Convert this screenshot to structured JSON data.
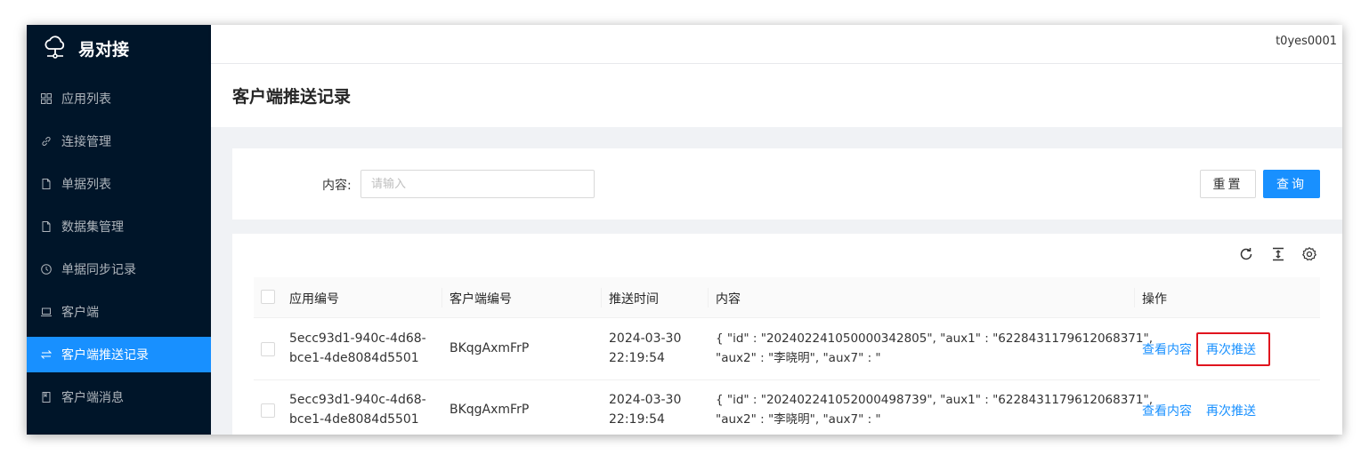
{
  "app": {
    "name": "易对接",
    "user": "t0yes0001"
  },
  "sidebar": {
    "items": [
      {
        "label": "应用列表",
        "icon": "grid-icon"
      },
      {
        "label": "连接管理",
        "icon": "link-icon"
      },
      {
        "label": "单据列表",
        "icon": "file-icon"
      },
      {
        "label": "数据集管理",
        "icon": "file-icon"
      },
      {
        "label": "单据同步记录",
        "icon": "clock-icon"
      },
      {
        "label": "客户端",
        "icon": "laptop-icon"
      },
      {
        "label": "客户端推送记录",
        "icon": "swap-icon",
        "active": true
      },
      {
        "label": "客户端消息",
        "icon": "book-icon"
      }
    ]
  },
  "page": {
    "title": "客户端推送记录"
  },
  "search": {
    "label": "内容:",
    "placeholder": "请输入",
    "reset_label": "重置",
    "query_label": "查询"
  },
  "table": {
    "columns": [
      "应用编号",
      "客户端编号",
      "推送时间",
      "内容",
      "操作"
    ],
    "rows": [
      {
        "app_id_line1": "5ecc93d1-940c-4d68-",
        "app_id_line2": "bce1-4de8084d5501",
        "client_id": "BKqgAxmFrP",
        "date": "2024-03-30",
        "time": "22:19:54",
        "content_line1": "{ \"id\" : \"20240224105000034280​5\", \"aux1\" : \"6228431179612068371\",",
        "content_line2": "\"aux2\" : \"李晓明\", \"aux7\" : \"",
        "action_view": "查看内容",
        "action_push": "再次推送"
      },
      {
        "app_id_line1": "5ecc93d1-940c-4d68-",
        "app_id_line2": "bce1-4de8084d5501",
        "client_id": "BKqgAxmFrP",
        "date": "2024-03-30",
        "time": "22:19:54",
        "content_line1": "{ \"id\" : \"20240224105200049873​9\", \"aux1\" : \"6228431179612068371\",",
        "content_line2": "\"aux2\" : \"李晓明\", \"aux7\" : \"",
        "action_view": "查看内容",
        "action_push": "再次推送"
      }
    ]
  },
  "colors": {
    "primary": "#1890ff",
    "sidebar_bg": "#001529",
    "highlight": "#e0141e"
  }
}
